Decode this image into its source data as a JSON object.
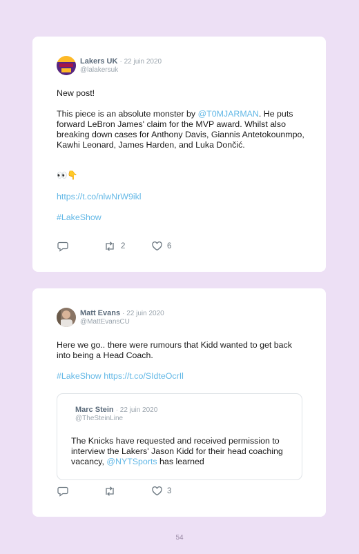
{
  "tweets": [
    {
      "author": "Lakers UK",
      "date": "· 22 juin 2020",
      "handle": "@lalakersuk",
      "text": {
        "line1": "New post!",
        "p2_before": "This piece is an absolute monster by ",
        "p2_mention": "@T0MJARMAN",
        "p2_after": ". He puts forward LeBron James' claim for the MVP award. Whilst also breaking down cases for Anthony Davis, Giannis Antetokounmpo, Kawhi Leonard, James Harden, and Luka Dončić.",
        "emoji": "👀👇",
        "link": "https://t.co/nlwNrW9ikl",
        "hashtag": "#LakeShow"
      },
      "retweets": "2",
      "likes": "6"
    },
    {
      "author": "Matt Evans",
      "date": "· 22 juin 2020",
      "handle": "@MattEvansCU",
      "text": {
        "p1": "Here we go.. there were rumours that Kidd wanted to get back into being a Head Coach.",
        "hashtag": "#LakeShow",
        "link": "https://t.co/SIdteOcrIl"
      },
      "likes": "3",
      "quoted": {
        "author": "Marc Stein",
        "date": "· 22 juin 2020",
        "handle": "@TheSteinLine",
        "text_before": "The Knicks have requested and received permission to interview the Lakers' Jason Kidd for their head coaching vacancy, ",
        "mention": "@NYTSports",
        "text_after": " has learned"
      }
    }
  ],
  "page_number": "54",
  "colors": {
    "link": "#63b8e6",
    "background": "#ede0f5",
    "card": "#ffffff",
    "lakers_purple": "#552583",
    "lakers_gold": "#fdb927"
  },
  "icons": [
    "reply-icon",
    "retweet-icon",
    "like-icon"
  ]
}
